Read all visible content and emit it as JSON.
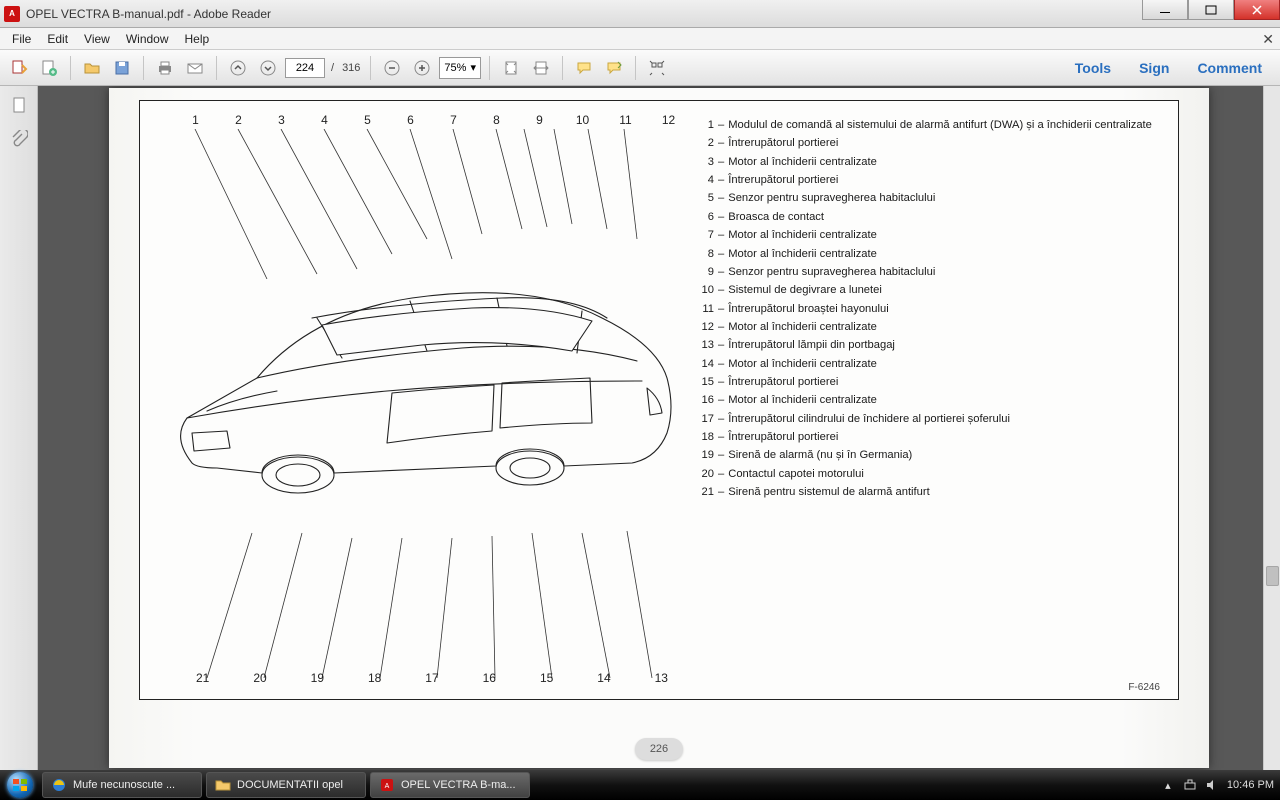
{
  "window": {
    "title": "OPEL VECTRA B-manual.pdf - Adobe Reader"
  },
  "menu": {
    "items": [
      "File",
      "Edit",
      "View",
      "Window",
      "Help"
    ]
  },
  "toolbar": {
    "page_current": "224",
    "page_total": "316",
    "page_sep": "/",
    "zoom": "75%",
    "tools": "Tools",
    "sign": "Sign",
    "comment": "Comment"
  },
  "document": {
    "page_number": "226",
    "figure_code": "F-6246",
    "callouts_top": [
      "1",
      "2",
      "3",
      "4",
      "5",
      "6",
      "7",
      "8",
      "9",
      "10",
      "11",
      "12"
    ],
    "callouts_bottom": [
      "21",
      "20",
      "19",
      "18",
      "17",
      "16",
      "15",
      "14",
      "13"
    ],
    "legend": [
      {
        "n": "1",
        "t": "Modulul de comandă al sistemului de alarmă antifurt (DWA) și a închiderii centralizate"
      },
      {
        "n": "2",
        "t": "Întrerupătorul portierei"
      },
      {
        "n": "3",
        "t": "Motor al închiderii centralizate"
      },
      {
        "n": "4",
        "t": "Întrerupătorul portierei"
      },
      {
        "n": "5",
        "t": "Senzor pentru supravegherea habitaclului"
      },
      {
        "n": "6",
        "t": "Broasca de contact"
      },
      {
        "n": "7",
        "t": "Motor al închiderii centralizate"
      },
      {
        "n": "8",
        "t": "Motor al închiderii centralizate"
      },
      {
        "n": "9",
        "t": "Senzor pentru supravegherea habitaclului"
      },
      {
        "n": "10",
        "t": "Sistemul de degivrare a lunetei"
      },
      {
        "n": "11",
        "t": "Întrerupătorul broaștei hayonului"
      },
      {
        "n": "12",
        "t": "Motor al închiderii centralizate"
      },
      {
        "n": "13",
        "t": "Întrerupătorul lămpii din portbagaj"
      },
      {
        "n": "14",
        "t": "Motor al închiderii centralizate"
      },
      {
        "n": "15",
        "t": "Întrerupătorul portierei"
      },
      {
        "n": "16",
        "t": "Motor al închiderii centralizate"
      },
      {
        "n": "17",
        "t": "Întrerupătorul cilindrului de închidere al portierei șoferului"
      },
      {
        "n": "18",
        "t": "Întrerupătorul portierei"
      },
      {
        "n": "19",
        "t": "Sirenă de alarmă (nu și în Germania)"
      },
      {
        "n": "20",
        "t": "Contactul capotei motorului"
      },
      {
        "n": "21",
        "t": "Sirenă pentru sistemul de alarmă antifurt"
      }
    ]
  },
  "taskbar": {
    "items": [
      {
        "label": "Mufe necunoscute ...",
        "icon": "ie"
      },
      {
        "label": "DOCUMENTATII opel",
        "icon": "folder"
      },
      {
        "label": "OPEL VECTRA B-ma...",
        "icon": "pdf",
        "active": true
      }
    ],
    "clock": "10:46 PM"
  }
}
